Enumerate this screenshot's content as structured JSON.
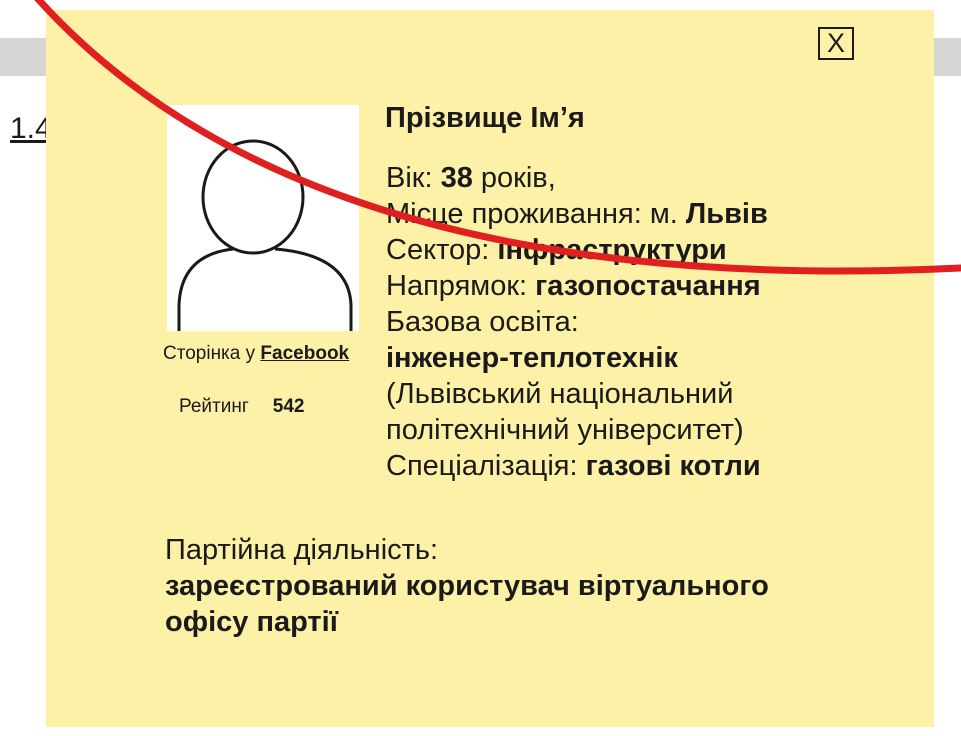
{
  "background": {
    "link_text": "1.4"
  },
  "card": {
    "close_label": "X",
    "name": "Прізвище Ім’я",
    "age_label": "Вік: ",
    "age_value": "38",
    "age_unit": " років,",
    "residence_label": "Місце проживання: м. ",
    "residence_value": "Львів",
    "sector_label": "Сектор: ",
    "sector_value": "інфраструктури",
    "direction_label": "Напрямок: ",
    "direction_value": "газопостачання",
    "education_label": "Базова освіта:",
    "education_value": "інженер-теплотехнік",
    "university_line1": "(Львівський національний",
    "university_line2": "політехнічний університет)",
    "specialization_label": "Спеціалізація: ",
    "specialization_value": "газові котли",
    "facebook_prefix": "Сторінка у ",
    "facebook_link": "Facebook",
    "rating_label": "Рейтинг",
    "rating_value": "542",
    "party_label": "Партійна діяльність:",
    "party_value_line1": "зареєстрований користувач віртуального",
    "party_value_line2": "офісу партії"
  },
  "icons": {
    "avatar": "person-silhouette-icon",
    "close": "close-icon"
  },
  "colors": {
    "card_background": "#fdf1a8",
    "strike_line": "#e02020",
    "background_bar": "#d6d6d6"
  }
}
